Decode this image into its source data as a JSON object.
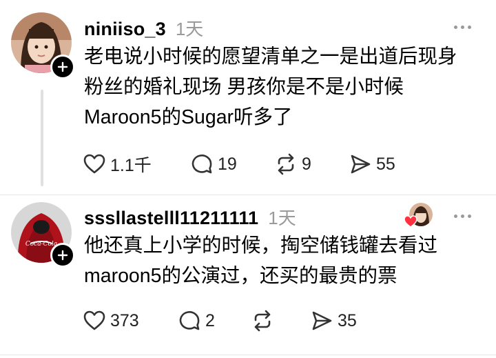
{
  "posts": [
    {
      "username": "niniiso_3",
      "time": "1天",
      "text": "老电说小时候的愿望清单之一是出道后现身\n粉丝的婚礼现场 男孩你是不是小时候\nMaroon5的Sugar听多了",
      "likes": "1.1千",
      "replies": "19",
      "reposts": "9",
      "shares": "55"
    },
    {
      "username": "sssllastelll11211111",
      "time": "1天",
      "text": "他还真上小学的时候，掏空储钱罐去看过\nmaroon5的公演过，还买的最贵的票",
      "likes": "373",
      "replies": "2",
      "reposts": "",
      "shares": "35"
    }
  ],
  "icons": {
    "like": "heart-icon",
    "reply": "comment-bubble-icon",
    "repost": "repost-arrows-icon",
    "share": "send-paper-plane-icon",
    "more": "more-dots-icon",
    "follow": "plus-icon"
  },
  "colors": {
    "time": "#9a9a9a",
    "liked_heart": "#ff3040",
    "follow_button": "#000000"
  }
}
